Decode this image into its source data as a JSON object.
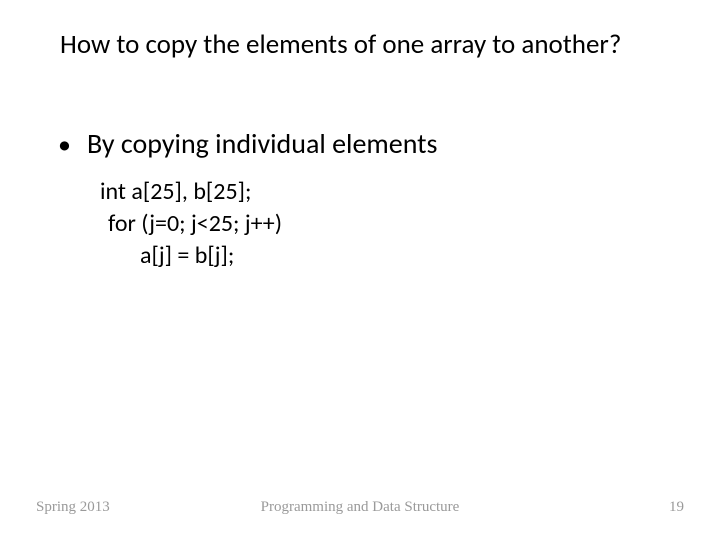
{
  "title": "How to copy the elements of one array to another?",
  "bullet1": "By copying individual elements",
  "code": {
    "line1": "int a[25], b[25];",
    "line2": "for  (j=0; j<25; j++)",
    "line3": "a[j] = b[j];"
  },
  "footer": {
    "left": "Spring 2013",
    "center": "Programming and Data Structure",
    "right": "19"
  }
}
